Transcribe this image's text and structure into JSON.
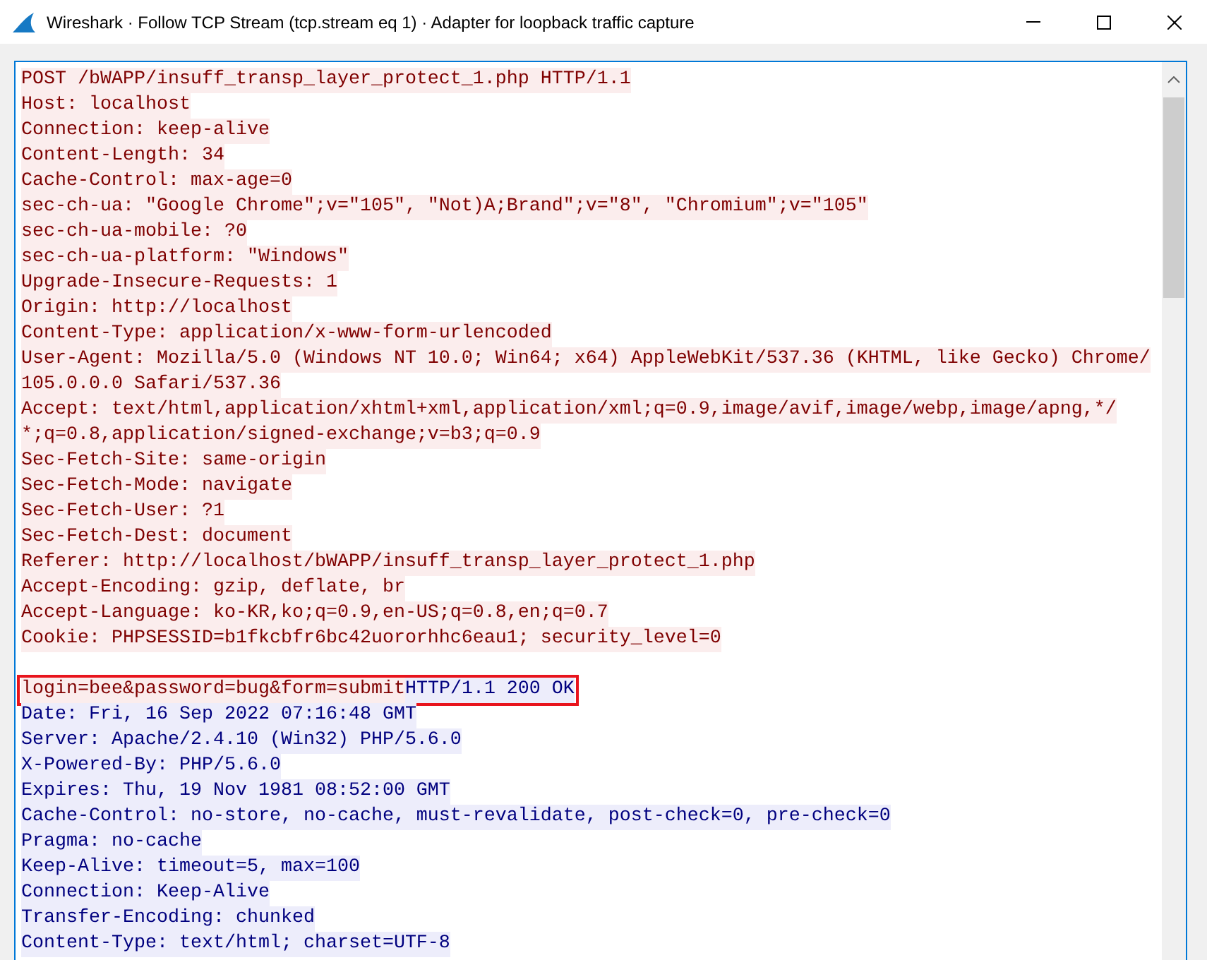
{
  "window": {
    "title": "Wireshark · Follow TCP Stream (tcp.stream eq 1) · Adapter for loopback traffic capture"
  },
  "stream": {
    "lines": [
      {
        "kind": "text",
        "segments": [
          {
            "kind": "client",
            "text": "POST /bWAPP/insuff_transp_layer_protect_1.php HTTP/1.1"
          }
        ]
      },
      {
        "kind": "text",
        "segments": [
          {
            "kind": "client",
            "text": "Host: localhost"
          }
        ]
      },
      {
        "kind": "text",
        "segments": [
          {
            "kind": "client",
            "text": "Connection: keep-alive"
          }
        ]
      },
      {
        "kind": "text",
        "segments": [
          {
            "kind": "client",
            "text": "Content-Length: 34"
          }
        ]
      },
      {
        "kind": "text",
        "segments": [
          {
            "kind": "client",
            "text": "Cache-Control: max-age=0"
          }
        ]
      },
      {
        "kind": "text",
        "segments": [
          {
            "kind": "client",
            "text": "sec-ch-ua: \"Google Chrome\";v=\"105\", \"Not)A;Brand\";v=\"8\", \"Chromium\";v=\"105\""
          }
        ]
      },
      {
        "kind": "text",
        "segments": [
          {
            "kind": "client",
            "text": "sec-ch-ua-mobile: ?0"
          }
        ]
      },
      {
        "kind": "text",
        "segments": [
          {
            "kind": "client",
            "text": "sec-ch-ua-platform: \"Windows\""
          }
        ]
      },
      {
        "kind": "text",
        "segments": [
          {
            "kind": "client",
            "text": "Upgrade-Insecure-Requests: 1"
          }
        ]
      },
      {
        "kind": "text",
        "segments": [
          {
            "kind": "client",
            "text": "Origin: http://localhost"
          }
        ]
      },
      {
        "kind": "text",
        "segments": [
          {
            "kind": "client",
            "text": "Content-Type: application/x-www-form-urlencoded"
          }
        ]
      },
      {
        "kind": "text",
        "segments": [
          {
            "kind": "client",
            "text": "User-Agent: Mozilla/5.0 (Windows NT 10.0; Win64; x64) AppleWebKit/537.36 (KHTML, like Gecko) Chrome/"
          }
        ]
      },
      {
        "kind": "text",
        "segments": [
          {
            "kind": "client",
            "text": "105.0.0.0 Safari/537.36"
          }
        ]
      },
      {
        "kind": "text",
        "segments": [
          {
            "kind": "client",
            "text": "Accept: text/html,application/xhtml+xml,application/xml;q=0.9,image/avif,image/webp,image/apng,*/"
          }
        ]
      },
      {
        "kind": "text",
        "segments": [
          {
            "kind": "client",
            "text": "*;q=0.8,application/signed-exchange;v=b3;q=0.9"
          }
        ]
      },
      {
        "kind": "text",
        "segments": [
          {
            "kind": "client",
            "text": "Sec-Fetch-Site: same-origin"
          }
        ]
      },
      {
        "kind": "text",
        "segments": [
          {
            "kind": "client",
            "text": "Sec-Fetch-Mode: navigate"
          }
        ]
      },
      {
        "kind": "text",
        "segments": [
          {
            "kind": "client",
            "text": "Sec-Fetch-User: ?1"
          }
        ]
      },
      {
        "kind": "text",
        "segments": [
          {
            "kind": "client",
            "text": "Sec-Fetch-Dest: document"
          }
        ]
      },
      {
        "kind": "text",
        "segments": [
          {
            "kind": "client",
            "text": "Referer: http://localhost/bWAPP/insuff_transp_layer_protect_1.php"
          }
        ]
      },
      {
        "kind": "text",
        "segments": [
          {
            "kind": "client",
            "text": "Accept-Encoding: gzip, deflate, br"
          }
        ]
      },
      {
        "kind": "text",
        "segments": [
          {
            "kind": "client",
            "text": "Accept-Language: ko-KR,ko;q=0.9,en-US;q=0.8,en;q=0.7"
          }
        ]
      },
      {
        "kind": "text",
        "segments": [
          {
            "kind": "client",
            "text": "Cookie: PHPSESSID=b1fkcbfr6bc42uororhhc6eau1; security_level=0"
          }
        ]
      },
      {
        "kind": "blank"
      },
      {
        "kind": "text",
        "highlighted": true,
        "segments": [
          {
            "kind": "client",
            "text": "login=bee&password=bug&form=submit"
          },
          {
            "kind": "server",
            "text": "HTTP/1.1 200 OK"
          }
        ]
      },
      {
        "kind": "text",
        "segments": [
          {
            "kind": "server",
            "text": "Date: Fri, 16 Sep 2022 07:16:48 GMT"
          }
        ]
      },
      {
        "kind": "text",
        "segments": [
          {
            "kind": "server",
            "text": "Server: Apache/2.4.10 (Win32) PHP/5.6.0"
          }
        ]
      },
      {
        "kind": "text",
        "segments": [
          {
            "kind": "server",
            "text": "X-Powered-By: PHP/5.6.0"
          }
        ]
      },
      {
        "kind": "text",
        "segments": [
          {
            "kind": "server",
            "text": "Expires: Thu, 19 Nov 1981 08:52:00 GMT"
          }
        ]
      },
      {
        "kind": "text",
        "segments": [
          {
            "kind": "server",
            "text": "Cache-Control: no-store, no-cache, must-revalidate, post-check=0, pre-check=0"
          }
        ]
      },
      {
        "kind": "text",
        "segments": [
          {
            "kind": "server",
            "text": "Pragma: no-cache"
          }
        ]
      },
      {
        "kind": "text",
        "segments": [
          {
            "kind": "server",
            "text": "Keep-Alive: timeout=5, max=100"
          }
        ]
      },
      {
        "kind": "text",
        "segments": [
          {
            "kind": "server",
            "text": "Connection: Keep-Alive"
          }
        ]
      },
      {
        "kind": "text",
        "segments": [
          {
            "kind": "server",
            "text": "Transfer-Encoding: chunked"
          }
        ]
      },
      {
        "kind": "text",
        "segments": [
          {
            "kind": "server",
            "text": "Content-Type: text/html; charset=UTF-8"
          }
        ]
      }
    ]
  }
}
